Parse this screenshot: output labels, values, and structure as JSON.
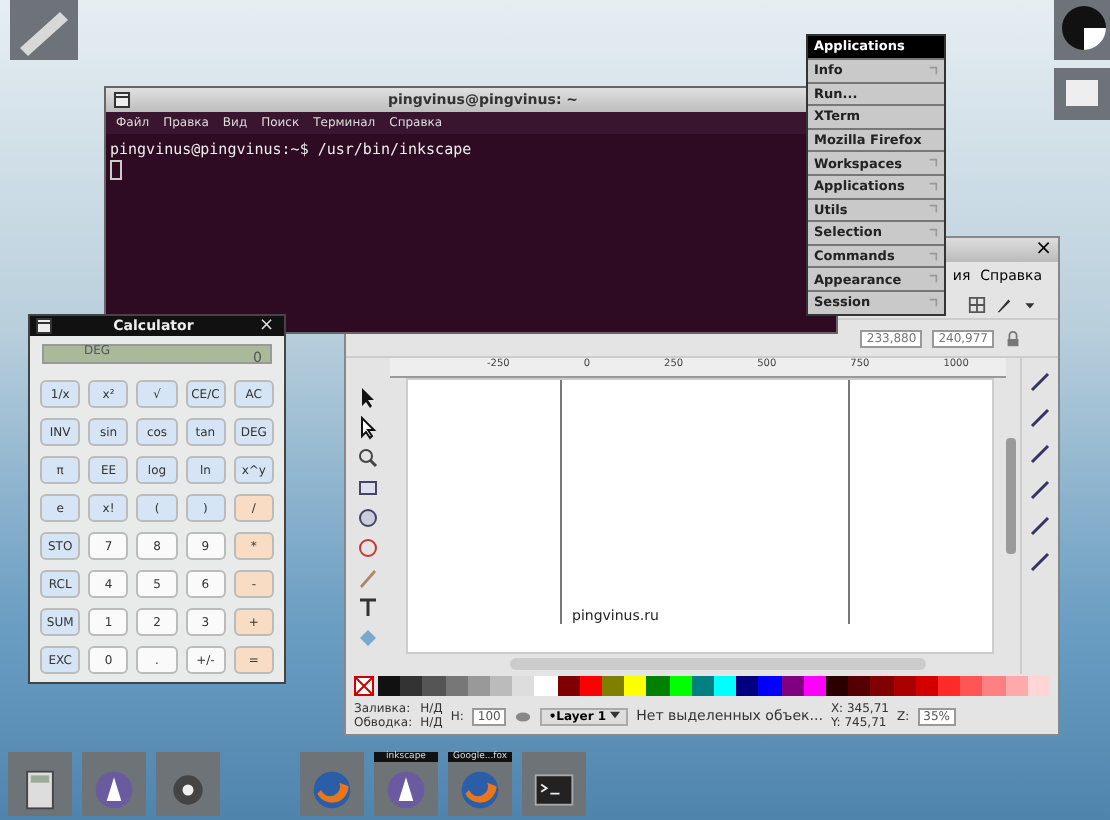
{
  "terminal": {
    "title": "pingvinus@pingvinus: ~",
    "menu": [
      "Файл",
      "Правка",
      "Вид",
      "Поиск",
      "Терминал",
      "Справка"
    ],
    "line": "pingvinus@pingvinus:~$ /usr/bin/inkscape"
  },
  "root_menu": {
    "title": "Applications",
    "items": [
      {
        "label": "Info",
        "submenu": true
      },
      {
        "label": "Run...",
        "submenu": false
      },
      {
        "label": "XTerm",
        "submenu": false
      },
      {
        "label": "Mozilla Firefox",
        "submenu": false
      },
      {
        "label": "Workspaces",
        "submenu": true
      },
      {
        "label": "Applications",
        "submenu": true
      },
      {
        "label": "Utils",
        "submenu": true
      },
      {
        "label": "Selection",
        "submenu": true
      },
      {
        "label": "Commands",
        "submenu": true
      },
      {
        "label": "Appearance",
        "submenu": true
      },
      {
        "label": "Session",
        "submenu": true
      }
    ]
  },
  "calculator": {
    "title": "Calculator",
    "close": "×",
    "display_value": "0",
    "display_mode": "DEG",
    "buttons": [
      {
        "label": "1/x",
        "kind": "func"
      },
      {
        "label": "x²",
        "kind": "func"
      },
      {
        "label": "√",
        "kind": "func"
      },
      {
        "label": "CE/C",
        "kind": "func"
      },
      {
        "label": "AC",
        "kind": "func"
      },
      {
        "label": "INV",
        "kind": "func"
      },
      {
        "label": "sin",
        "kind": "func"
      },
      {
        "label": "cos",
        "kind": "func"
      },
      {
        "label": "tan",
        "kind": "func"
      },
      {
        "label": "DEG",
        "kind": "func"
      },
      {
        "label": "π",
        "kind": "func"
      },
      {
        "label": "EE",
        "kind": "func"
      },
      {
        "label": "log",
        "kind": "func"
      },
      {
        "label": "ln",
        "kind": "func"
      },
      {
        "label": "x^y",
        "kind": "func"
      },
      {
        "label": "e",
        "kind": "func"
      },
      {
        "label": "x!",
        "kind": "func"
      },
      {
        "label": "(",
        "kind": "func"
      },
      {
        "label": ")",
        "kind": "func"
      },
      {
        "label": "/",
        "kind": "op"
      },
      {
        "label": "STO",
        "kind": "func"
      },
      {
        "label": "7",
        "kind": "num"
      },
      {
        "label": "8",
        "kind": "num"
      },
      {
        "label": "9",
        "kind": "num"
      },
      {
        "label": "*",
        "kind": "op"
      },
      {
        "label": "RCL",
        "kind": "func"
      },
      {
        "label": "4",
        "kind": "num"
      },
      {
        "label": "5",
        "kind": "num"
      },
      {
        "label": "6",
        "kind": "num"
      },
      {
        "label": "-",
        "kind": "op"
      },
      {
        "label": "SUM",
        "kind": "func"
      },
      {
        "label": "1",
        "kind": "num"
      },
      {
        "label": "2",
        "kind": "num"
      },
      {
        "label": "3",
        "kind": "num"
      },
      {
        "label": "+",
        "kind": "op"
      },
      {
        "label": "EXC",
        "kind": "func"
      },
      {
        "label": "0",
        "kind": "num"
      },
      {
        "label": ".",
        "kind": "num"
      },
      {
        "label": "+/-",
        "kind": "num"
      },
      {
        "label": "=",
        "kind": "op"
      }
    ]
  },
  "inkscape": {
    "close": "×",
    "menu": [
      "ия",
      "Справка"
    ],
    "x_field": "233,880",
    "y_field": "240,977",
    "ruler_labels": [
      "-250",
      "0",
      "250",
      "500",
      "750",
      "1000"
    ],
    "canvas_text": "pingvinus.ru",
    "palette": [
      {
        "color": "#111111"
      },
      {
        "color": "#333333"
      },
      {
        "color": "#555555"
      },
      {
        "color": "#777777"
      },
      {
        "color": "#999999"
      },
      {
        "color": "#bbbbbb"
      },
      {
        "color": "#dddddd"
      },
      {
        "color": "#ffffff"
      },
      {
        "color": "#800000"
      },
      {
        "color": "#ff0000"
      },
      {
        "color": "#808000"
      },
      {
        "color": "#ffff00"
      },
      {
        "color": "#008000"
      },
      {
        "color": "#00ff00"
      },
      {
        "color": "#008080"
      },
      {
        "color": "#00ffff"
      },
      {
        "color": "#000080"
      },
      {
        "color": "#0000ff"
      },
      {
        "color": "#800080"
      },
      {
        "color": "#ff00ff"
      },
      {
        "color": "#2b0000"
      },
      {
        "color": "#550000"
      },
      {
        "color": "#800000"
      },
      {
        "color": "#aa0000"
      },
      {
        "color": "#d40000"
      },
      {
        "color": "#ff2a2a"
      },
      {
        "color": "#ff5555"
      },
      {
        "color": "#ff8080"
      },
      {
        "color": "#ffaaaa"
      },
      {
        "color": "#ffd5d5"
      }
    ],
    "fill_label": "Заливка:",
    "fill_value": "Н/Д",
    "stroke_label": "Обводка:",
    "stroke_value": "Н/Д",
    "opacity_label": "Н:",
    "opacity": "100",
    "layer": "•Layer 1",
    "status": "Нет выделенных объек...",
    "x_coord": "X: 345,71",
    "y_coord": "Y: 745,71",
    "zoom_label": "Z:",
    "zoom": "35%"
  },
  "taskbar": [
    {
      "kind": "calculator"
    },
    {
      "kind": "inkscape"
    },
    {
      "kind": "settings"
    },
    {
      "kind": "gap"
    },
    {
      "kind": "firefox"
    },
    {
      "kind": "inkscape",
      "label": "inkscape"
    },
    {
      "kind": "firefox",
      "label": "Google...fox"
    },
    {
      "kind": "terminal"
    }
  ]
}
